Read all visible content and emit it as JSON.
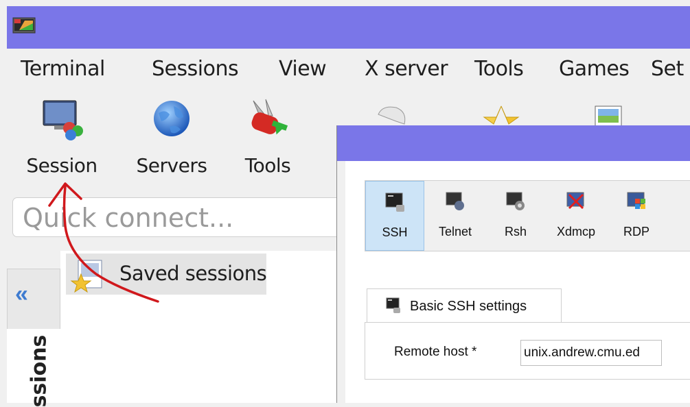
{
  "main_window": {
    "menu": [
      "Terminal",
      "Sessions",
      "View",
      "X server",
      "Tools",
      "Games",
      "Set"
    ],
    "toolbar": [
      {
        "label": "Session",
        "icon": "monitor-session-icon"
      },
      {
        "label": "Servers",
        "icon": "globe-icon"
      },
      {
        "label": "Tools",
        "icon": "swiss-knife-icon"
      },
      {
        "label": "",
        "icon": "gamepad-icon"
      },
      {
        "label": "",
        "icon": "star-icon"
      },
      {
        "label": "",
        "icon": "picture-icon"
      }
    ],
    "quick_connect_placeholder": "Quick connect...",
    "saved_sessions_label": "Saved sessions",
    "sidebar_collapse_label": "«",
    "sidebar_vertical_label": "ssions"
  },
  "session_dialog": {
    "session_types": [
      {
        "label": "SSH",
        "icon": "ssh-terminal-icon",
        "selected": true
      },
      {
        "label": "Telnet",
        "icon": "telnet-icon",
        "selected": false
      },
      {
        "label": "Rsh",
        "icon": "rsh-icon",
        "selected": false
      },
      {
        "label": "Xdmcp",
        "icon": "xdmcp-icon",
        "selected": false
      },
      {
        "label": "RDP",
        "icon": "rdp-icon",
        "selected": false
      }
    ],
    "basic_tab_label": "Basic SSH settings",
    "remote_host_label": "Remote host *",
    "remote_host_value": "unix.andrew.cmu.ed"
  },
  "colors": {
    "titlebar": "#7a76e8",
    "selected_type": "#cde4f7",
    "annotation_arrow": "#d0181c"
  }
}
